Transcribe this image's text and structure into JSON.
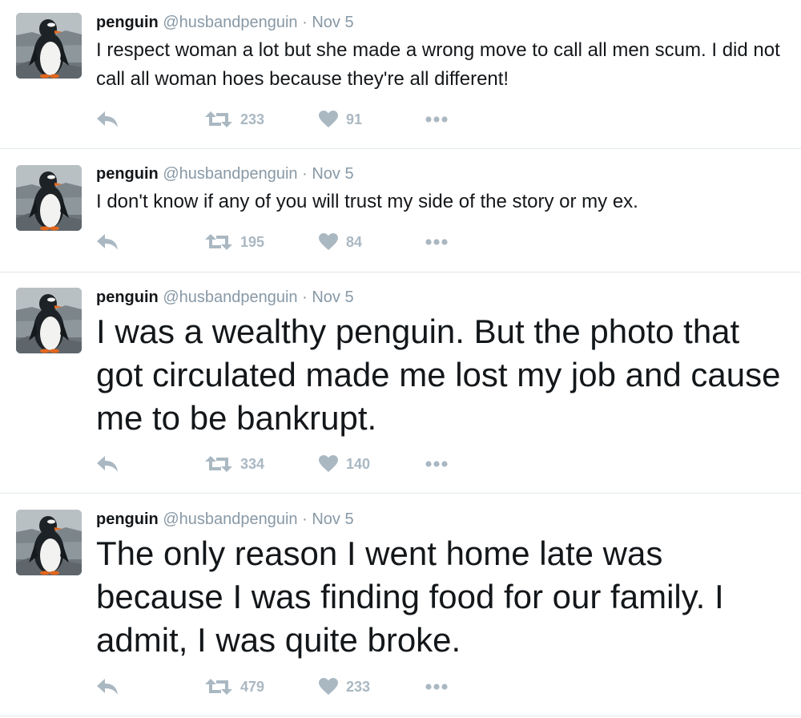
{
  "colors": {
    "text": "#14171a",
    "secondary": "#8899a6",
    "action_icon": "#aab8c2",
    "divider": "#e1e8ed"
  },
  "icons": {
    "reply": "reply-arrow-icon",
    "retweet": "retweet-icon",
    "like": "heart-icon",
    "more": "more-dots-icon",
    "avatar": "penguin-photo"
  },
  "tweets": [
    {
      "name": "penguin",
      "handle": "@husbandpenguin",
      "separator": "·",
      "date": "Nov 5",
      "text": "I respect woman a lot but she made a wrong move to call all men scum. I did not call all woman hoes because they're all different!",
      "retweets": "233",
      "likes": "91"
    },
    {
      "name": "penguin",
      "handle": "@husbandpenguin",
      "separator": "·",
      "date": "Nov 5",
      "text": "I don't know if any of you will trust my side of the story or my ex.",
      "retweets": "195",
      "likes": "84"
    },
    {
      "name": "penguin",
      "handle": "@husbandpenguin",
      "separator": "·",
      "date": "Nov 5",
      "text": "I was a wealthy penguin. But the photo that got circulated made me lost my job and cause me to be bankrupt.",
      "retweets": "334",
      "likes": "140"
    },
    {
      "name": "penguin",
      "handle": "@husbandpenguin",
      "separator": "·",
      "date": "Nov 5",
      "text": "The only reason I went home late was because I was finding food for our family. I admit, I was quite broke.",
      "retweets": "479",
      "likes": "233"
    }
  ]
}
